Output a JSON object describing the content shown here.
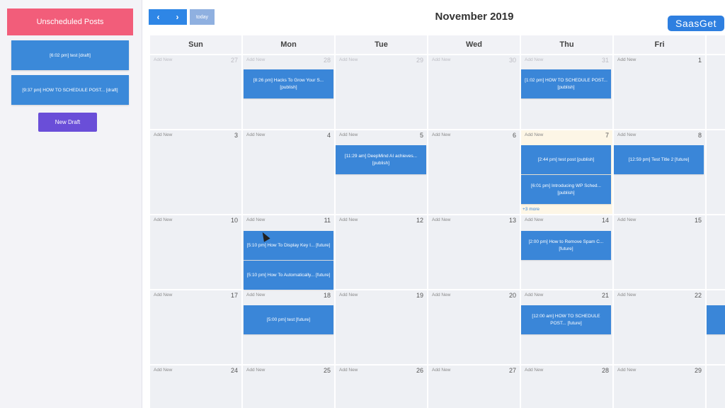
{
  "sidebar": {
    "header": "Unscheduled Posts",
    "drafts": [
      "[6:02 pm] test [draft]",
      "[9:37 pm] HOW TO SCHEDULE POST... [draft]"
    ],
    "new_draft": "New Draft"
  },
  "toolbar": {
    "prev_icon": "‹",
    "next_icon": "›",
    "today": "today",
    "title": "November 2019"
  },
  "brand": "SaasGet",
  "days": [
    "Sun",
    "Mon",
    "Tue",
    "Wed",
    "Thu",
    "Fri"
  ],
  "add_label": "Add New",
  "weeks": [
    [
      "27",
      "28",
      "29",
      "30",
      "31",
      "1"
    ],
    [
      "3",
      "4",
      "5",
      "6",
      "7",
      "8"
    ],
    [
      "10",
      "11",
      "12",
      "13",
      "14",
      "15"
    ],
    [
      "17",
      "18",
      "19",
      "20",
      "21",
      "22"
    ],
    [
      "24",
      "25",
      "26",
      "27",
      "28",
      "29"
    ]
  ],
  "events": {
    "w0_mon": "[8:26 pm] Hacks To Grow Your S... [publish]",
    "w0_thu": "[1:02 pm] HOW TO SCHEDULE POST... [publish]",
    "w1_tue": "[11:29 am] DeepMind AI achieves... [publish]",
    "w1_thu_a": "[2:44 pm] test post [publish]",
    "w1_thu_b": "[6:01 pm] Introducing WP Sched... [publish]",
    "w1_thu_more": "+3 more",
    "w1_fri": "[12:59 pm] Test Title 2 [future]",
    "w2_mon_a": "[5:10 pm] How To Display Key I... [future]",
    "w2_mon_b": "[5:10 pm] How To Automatically... [future]",
    "w2_thu": "[2:00 pm] How to Remove Spam C... [future]",
    "w3_mon": "[5:00 pm] test [future]",
    "w3_thu": "[12:00 am] HOW TO SCHEDULE POST... [future]"
  }
}
